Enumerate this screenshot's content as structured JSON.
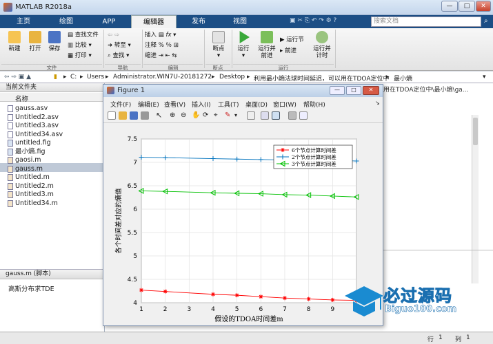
{
  "window": {
    "title": "MATLAB R2018a",
    "min": "—",
    "max": "□",
    "close": "✕"
  },
  "tabs": [
    {
      "label": "主页"
    },
    {
      "label": "绘图"
    },
    {
      "label": "APP"
    },
    {
      "label": "编辑器"
    },
    {
      "label": "发布"
    },
    {
      "label": "视图"
    }
  ],
  "search": {
    "placeholder": "搜索文档"
  },
  "ribbon": {
    "file": {
      "new": "新建",
      "open": "打开",
      "save": "保存",
      "find_files": "查找文件",
      "compare": "比较",
      "print": "打印",
      "section": "文件"
    },
    "nav": {
      "goto": "转至",
      "find": "查找",
      "section": "导航"
    },
    "edit": {
      "insert": "插入",
      "comment": "注释",
      "indent": "缩进",
      "section": "编辑"
    },
    "breakpoint": {
      "label": "断点",
      "section": "断点"
    },
    "run": {
      "run": "运行",
      "run_advance_1": "运行并",
      "run_advance_2": "前进",
      "run_section": "运行节",
      "advance": "前进",
      "run_time_1": "运行并",
      "run_time_2": "计时",
      "section": "运行"
    }
  },
  "address": {
    "path": [
      "C:",
      "Users",
      "Administrator.WIN7U-20181272",
      "Desktop",
      "利用最小熵法球时间延迟，可以用在TDOA定位中",
      "最小熵"
    ]
  },
  "left_panel": {
    "title": "当前文件夹",
    "col_name": "名称",
    "files": [
      "gauss.asv",
      "Untitled2.asv",
      "Untitled3.asv",
      "Untitled34.asv",
      "untitled.fig",
      "最小熵.fig",
      "gaosi.m",
      "gauss.m",
      "Untitled.m",
      "Untitled2.m",
      "Untitled3.m",
      "Untitled34.m"
    ],
    "selected": "gauss.m"
  },
  "detail": {
    "title": "gauss.m  (脚本)",
    "description": "高斯分布求TDE"
  },
  "editor": {
    "tab_text": "用在TDOA定位中\\最小熵\\ga..."
  },
  "figure": {
    "title": "Figure 1",
    "menu": [
      "文件(F)",
      "编辑(E)",
      "查看(V)",
      "插入(I)",
      "工具(T)",
      "桌面(D)",
      "窗口(W)",
      "帮助(H)"
    ]
  },
  "status": {
    "row_label": "行",
    "row": "1",
    "col_label": "列",
    "col": "1"
  },
  "watermark": {
    "text1": "必过源码",
    "text2": "Biguo100.com"
  },
  "chart_data": {
    "type": "line",
    "xlabel": "假设的TDOA时间差m",
    "ylabel": "各个时间差对应的熵值",
    "xlim": [
      1,
      10
    ],
    "ylim": [
      4,
      7.5
    ],
    "xticks": [
      1,
      2,
      3,
      4,
      5,
      6,
      7,
      8,
      9,
      10
    ],
    "yticks": [
      4,
      4.5,
      5,
      5.5,
      6,
      6.5,
      7,
      7.5
    ],
    "grid": true,
    "legend_position": "top-right",
    "series": [
      {
        "name": "6个节点计算时间差",
        "color": "#ff0000",
        "marker": "star",
        "x": [
          1,
          2,
          4,
          5,
          6,
          7,
          8,
          9,
          10
        ],
        "values": [
          4.27,
          4.24,
          4.18,
          4.16,
          4.13,
          4.1,
          4.08,
          4.06,
          4.05
        ]
      },
      {
        "name": "2个节点计算时间差",
        "color": "#0072bd",
        "marker": "plus",
        "x": [
          1,
          2,
          4,
          5,
          6,
          7,
          8,
          9,
          10
        ],
        "values": [
          7.11,
          7.1,
          7.08,
          7.07,
          7.06,
          7.05,
          7.05,
          7.04,
          7.03
        ]
      },
      {
        "name": "3个节点计算时间差",
        "color": "#00c000",
        "marker": "triangle-left",
        "x": [
          1,
          2,
          4,
          5,
          6,
          7,
          8,
          9,
          10
        ],
        "values": [
          6.39,
          6.38,
          6.35,
          6.34,
          6.33,
          6.31,
          6.3,
          6.28,
          6.26
        ]
      }
    ]
  }
}
